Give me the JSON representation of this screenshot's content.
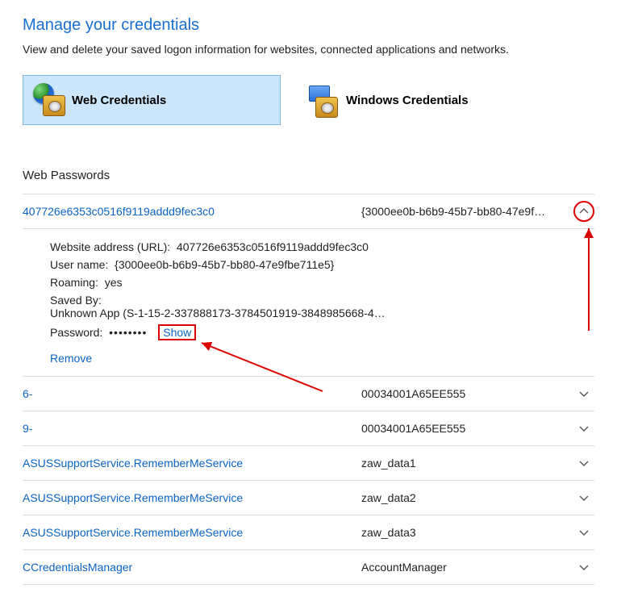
{
  "page": {
    "title": "Manage your credentials",
    "subtitle": "View and delete your saved logon information for websites, connected applications and networks."
  },
  "tabs": {
    "web": "Web Credentials",
    "windows": "Windows Credentials"
  },
  "section_title": "Web Passwords",
  "expanded": {
    "left": "407726e6353c0516f9119addd9fec3c0",
    "right": "{3000ee0b-b6b9-45b7-bb80-47e9f…",
    "detail": {
      "url_label": "Website address (URL)",
      "url_value": "407726e6353c0516f9119addd9fec3c0",
      "user_label": "User name",
      "user_value": "{3000ee0b-b6b9-45b7-bb80-47e9fbe711e5}",
      "roaming_label": "Roaming",
      "roaming_value": "yes",
      "savedby_label": "Saved By:",
      "savedby_value": "Unknown App (S-1-15-2-337888173-3784501919-3848985668-4…",
      "password_label": "Password",
      "password_mask": "••••••••",
      "show": "Show",
      "remove": "Remove"
    }
  },
  "rows": [
    {
      "left": "6-",
      "right": "00034001A65EE555"
    },
    {
      "left": "9-",
      "right": "00034001A65EE555"
    },
    {
      "left": "ASUSSupportService.RememberMeService",
      "right": "zaw_data1"
    },
    {
      "left": "ASUSSupportService.RememberMeService",
      "right": "zaw_data2"
    },
    {
      "left": "ASUSSupportService.RememberMeService",
      "right": "zaw_data3"
    },
    {
      "left": "CCredentialsManager",
      "right": "AccountManager"
    }
  ]
}
